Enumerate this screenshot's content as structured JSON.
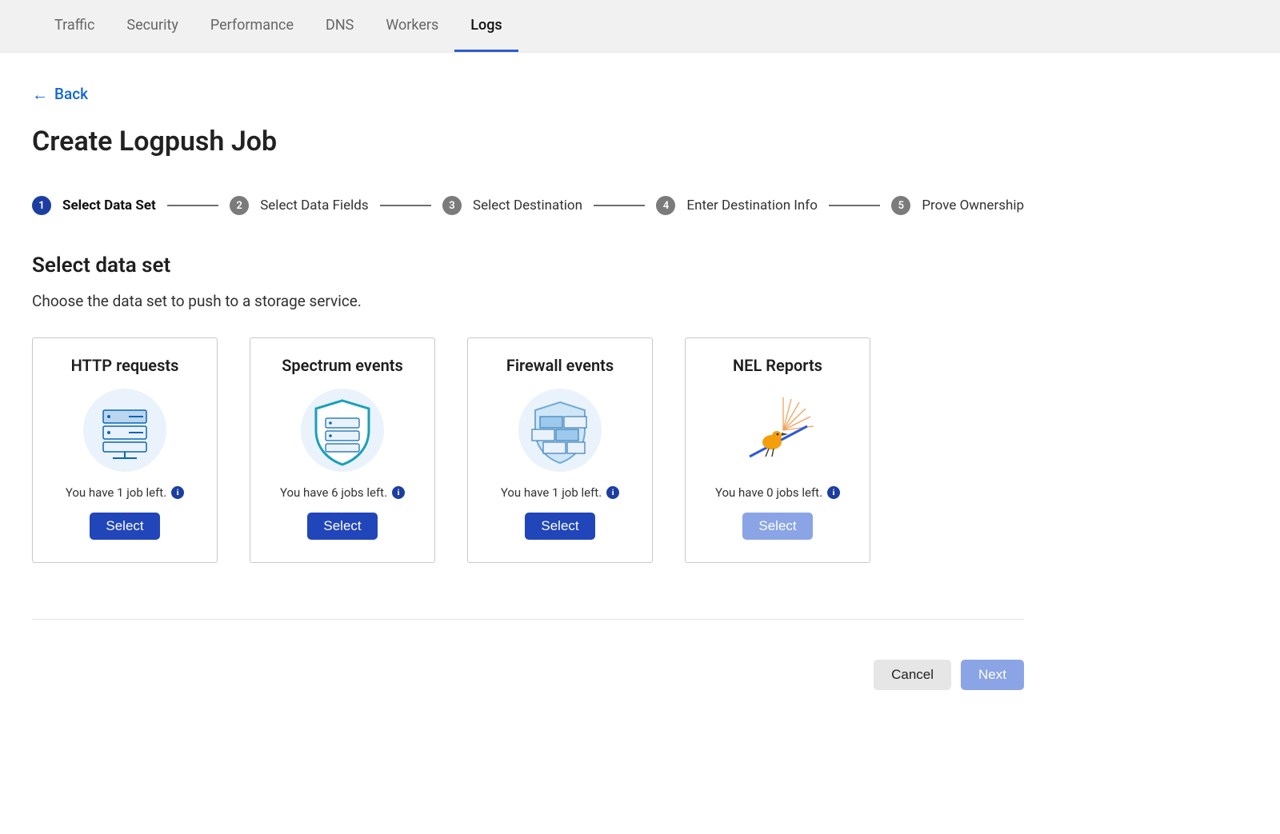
{
  "nav": {
    "tabs": [
      {
        "label": "Traffic",
        "active": false
      },
      {
        "label": "Security",
        "active": false
      },
      {
        "label": "Performance",
        "active": false
      },
      {
        "label": "DNS",
        "active": false
      },
      {
        "label": "Workers",
        "active": false
      },
      {
        "label": "Logs",
        "active": true
      }
    ]
  },
  "back_label": "Back",
  "page_title": "Create Logpush Job",
  "steps": [
    {
      "num": "1",
      "label": "Select Data Set",
      "active": true
    },
    {
      "num": "2",
      "label": "Select Data Fields",
      "active": false
    },
    {
      "num": "3",
      "label": "Select Destination",
      "active": false
    },
    {
      "num": "4",
      "label": "Enter Destination Info",
      "active": false
    },
    {
      "num": "5",
      "label": "Prove Ownership",
      "active": false
    }
  ],
  "section": {
    "title": "Select data set",
    "description": "Choose the data set to push to a storage service."
  },
  "cards": [
    {
      "title": "HTTP requests",
      "jobs_text": "You have 1 job left.",
      "select_label": "Select",
      "disabled": false
    },
    {
      "title": "Spectrum events",
      "jobs_text": "You have 6 jobs left.",
      "select_label": "Select",
      "disabled": false
    },
    {
      "title": "Firewall events",
      "jobs_text": "You have 1 job left.",
      "select_label": "Select",
      "disabled": false
    },
    {
      "title": "NEL Reports",
      "jobs_text": "You have 0 jobs left.",
      "select_label": "Select",
      "disabled": true
    }
  ],
  "footer": {
    "cancel": "Cancel",
    "next": "Next"
  },
  "info_glyph": "i"
}
